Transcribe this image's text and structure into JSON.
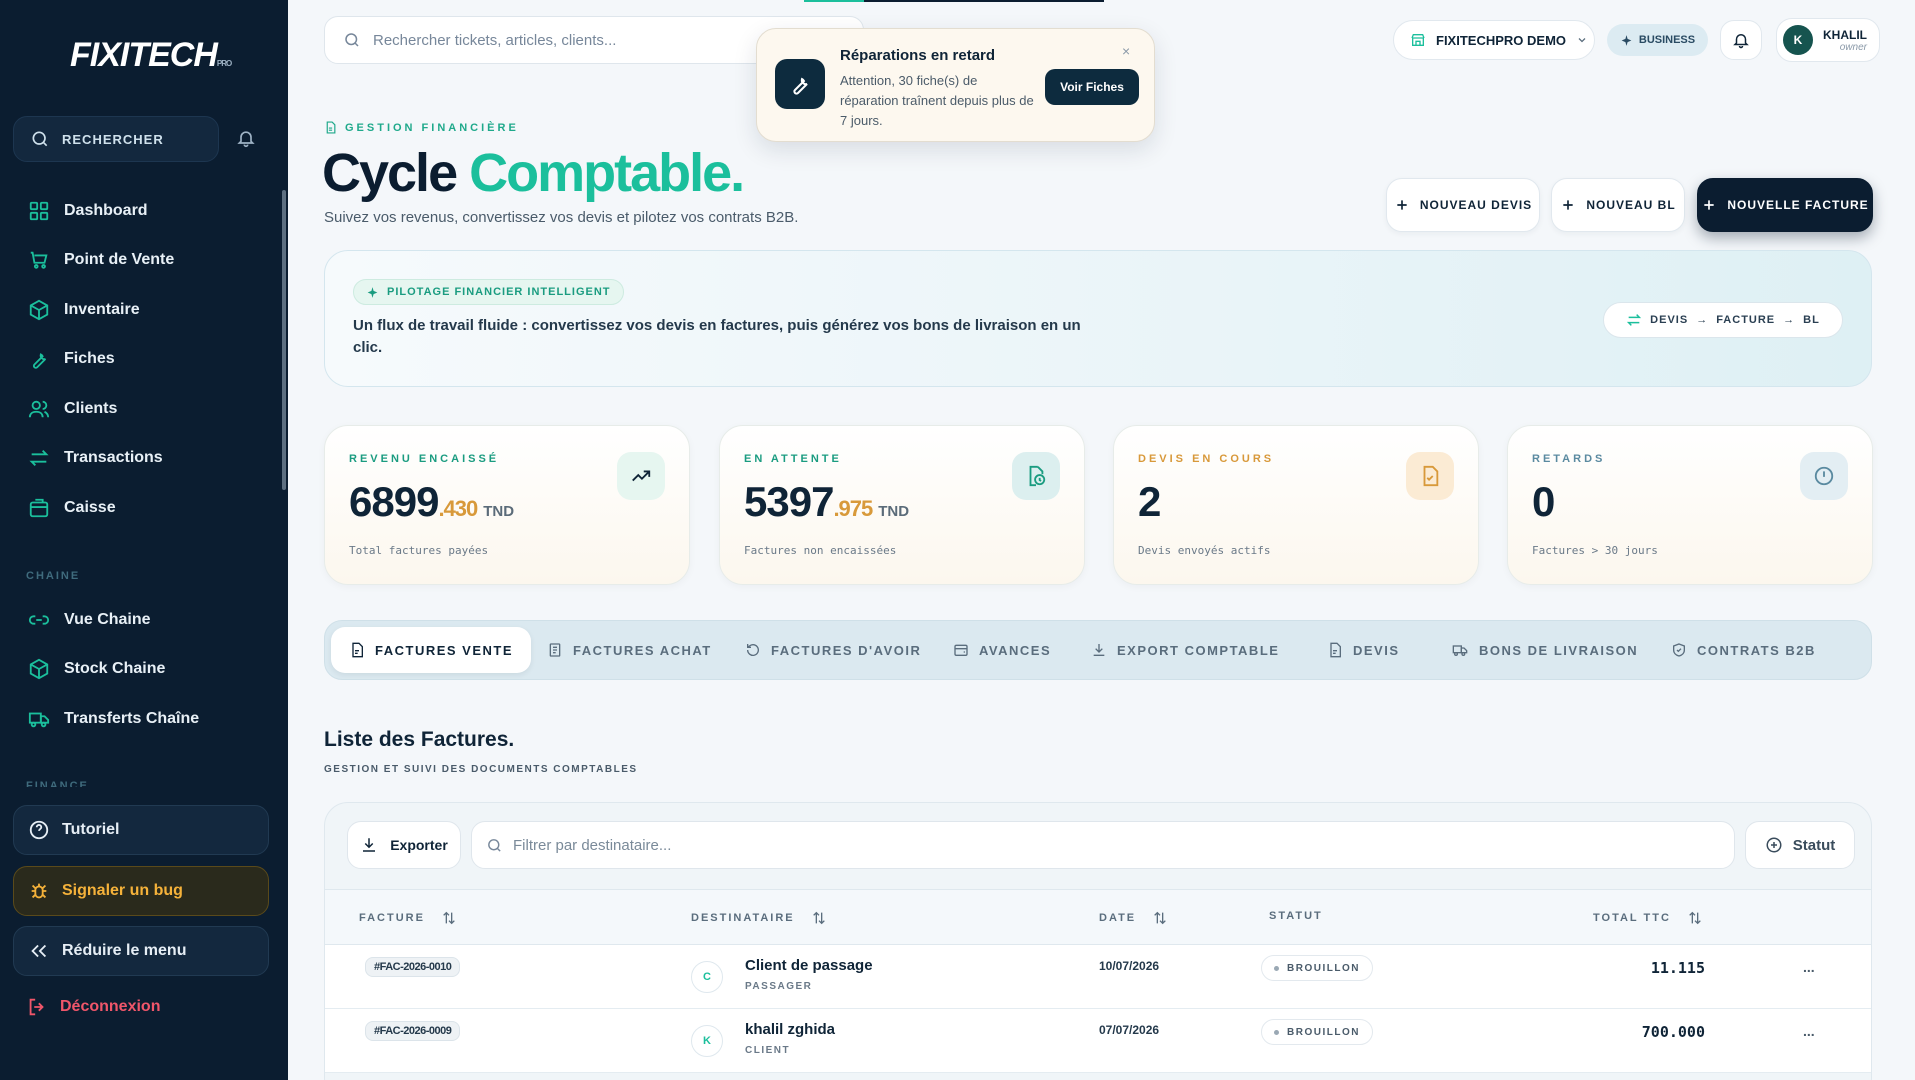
{
  "app": {
    "logo": "FIXITECH",
    "logo_small": "PRO"
  },
  "sidebar": {
    "search_label": "RECHERCHER",
    "items": [
      {
        "label": "Dashboard",
        "icon": "dashboard-icon"
      },
      {
        "label": "Point de Vente",
        "icon": "cart-icon"
      },
      {
        "label": "Inventaire",
        "icon": "box-icon"
      },
      {
        "label": "Fiches",
        "icon": "wrench-icon"
      },
      {
        "label": "Clients",
        "icon": "users-icon"
      },
      {
        "label": "Transactions",
        "icon": "swap-icon"
      },
      {
        "label": "Caisse",
        "icon": "register-icon"
      }
    ],
    "section_chain": "CHAINE",
    "chain_items": [
      {
        "label": "Vue Chaine",
        "icon": "link-icon"
      },
      {
        "label": "Stock Chaine",
        "icon": "box-icon"
      },
      {
        "label": "Transferts Chaîne",
        "icon": "truck-icon"
      }
    ],
    "section_finance": "FINANCE",
    "tutorial": "Tutoriel",
    "bug": "Signaler un bug",
    "collapse": "Réduire le menu",
    "logout": "Déconnexion"
  },
  "topbar": {
    "search_placeholder": "Rechercher tickets, articles, clients...",
    "store": "FIXITECHPRO DEMO",
    "plan": "BUSINESS",
    "user_initial": "K",
    "user_name": "KHALIL",
    "user_role": "owner"
  },
  "toast": {
    "title": "Réparations en retard",
    "text": "Attention, 30 fiche(s) de réparation traînent depuis plus de 7 jours.",
    "button": "Voir Fiches",
    "close": "×"
  },
  "header": {
    "eyebrow": "GESTION FINANCIÈRE",
    "title_main": "Cycle",
    "title_accent": "Comptable.",
    "subtitle": "Suivez vos revenus, convertissez vos devis et pilotez vos contrats B2B.",
    "btn_devis": "NOUVEAU DEVIS",
    "btn_bl": "NOUVEAU BL",
    "btn_facture": "NOUVELLE FACTURE"
  },
  "banner": {
    "pill": "PILOTAGE FINANCIER INTELLIGENT",
    "text": "Un flux de travail fluide : convertissez vos devis en factures, puis générez vos bons de livraison en un clic.",
    "flow_1": "DEVIS",
    "flow_2": "FACTURE",
    "flow_3": "BL",
    "arrow": "→"
  },
  "kpis": [
    {
      "label": "REVENU ENCAISSÉ",
      "int": "6899",
      "dec": ".430",
      "unit": "TND",
      "sub": "Total factures payées",
      "color": "#1a9c80"
    },
    {
      "label": "EN ATTENTE",
      "int": "5397",
      "dec": ".975",
      "unit": "TND",
      "sub": "Factures non encaissées",
      "color": "#1a9c80"
    },
    {
      "label": "DEVIS EN COURS",
      "int": "2",
      "dec": "",
      "unit": "",
      "sub": "Devis envoyés actifs",
      "color": "#d8993a"
    },
    {
      "label": "RETARDS",
      "int": "0",
      "dec": "",
      "unit": "",
      "sub": "Factures > 30 jours",
      "color": "#5a8aa0"
    }
  ],
  "tabs": [
    {
      "label": "FACTURES VENTE",
      "icon": "invoice-icon",
      "active": true
    },
    {
      "label": "FACTURES ACHAT",
      "icon": "document-icon"
    },
    {
      "label": "FACTURES D'AVOIR",
      "icon": "undo-icon"
    },
    {
      "label": "AVANCES",
      "icon": "wallet-icon"
    },
    {
      "label": "EXPORT COMPTABLE",
      "icon": "download-icon"
    },
    {
      "label": "DEVIS",
      "icon": "document-icon"
    },
    {
      "label": "BONS DE LIVRAISON",
      "icon": "truck-icon"
    },
    {
      "label": "CONTRATS B2B",
      "icon": "shield-icon"
    }
  ],
  "list": {
    "title": "Liste des Factures.",
    "subtitle": "GESTION ET SUIVI DES DOCUMENTS COMPTABLES",
    "export": "Exporter",
    "filter_placeholder": "Filtrer par destinataire...",
    "status_btn": "Statut",
    "columns": {
      "invoice": "FACTURE",
      "recipient": "DESTINATAIRE",
      "date": "DATE",
      "status": "STATUT",
      "total": "TOTAL TTC"
    },
    "rows": [
      {
        "id": "#FAC-2026-0010",
        "initial": "C",
        "name": "Client de passage",
        "type": "PASSAGER",
        "date": "10/07/2026",
        "status": "BROUILLON",
        "total": "11.115",
        "menu": "..."
      },
      {
        "id": "#FAC-2026-0009",
        "initial": "K",
        "name": "khalil zghida",
        "type": "CLIENT",
        "date": "07/07/2026",
        "status": "BROUILLON",
        "total": "700.000",
        "menu": "..."
      }
    ]
  },
  "colors": {
    "accent": "#1bbf9c",
    "sidebar": "#0b1d30",
    "warning": "#d8993a",
    "danger": "#f0566a"
  }
}
